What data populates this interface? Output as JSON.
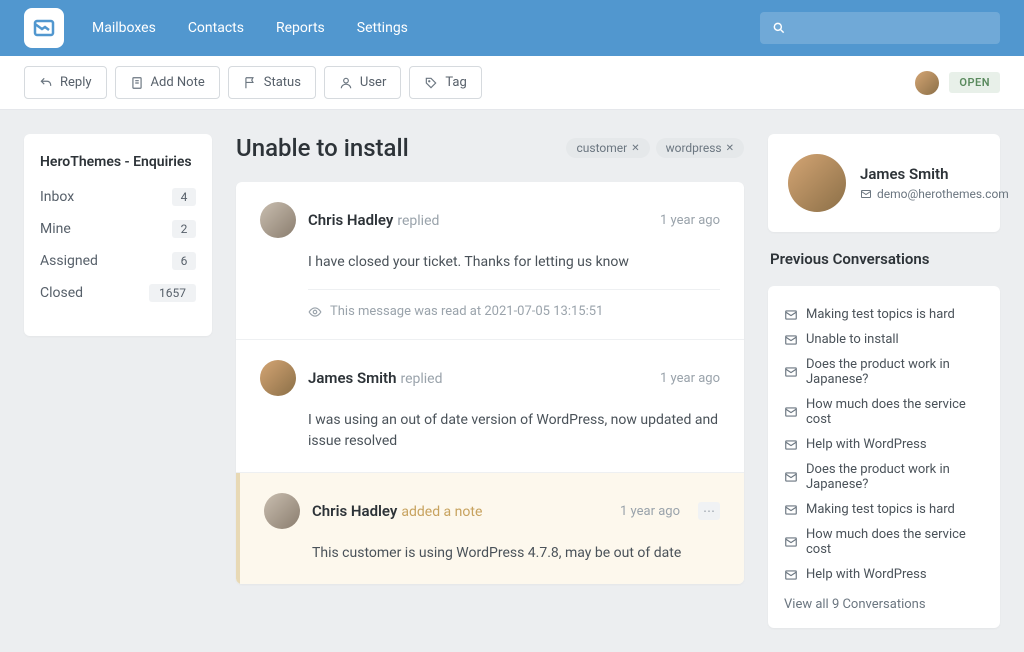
{
  "nav": {
    "items": [
      "Mailboxes",
      "Contacts",
      "Reports",
      "Settings"
    ]
  },
  "toolbar": {
    "reply": "Reply",
    "add_note": "Add Note",
    "status": "Status",
    "user": "User",
    "tag": "Tag",
    "status_badge": "OPEN"
  },
  "sidebar": {
    "title": "HeroThemes - Enquiries",
    "items": [
      {
        "label": "Inbox",
        "count": "4"
      },
      {
        "label": "Mine",
        "count": "2"
      },
      {
        "label": "Assigned",
        "count": "6"
      },
      {
        "label": "Closed",
        "count": "1657"
      }
    ]
  },
  "ticket": {
    "title": "Unable to install",
    "tags": [
      "customer",
      "wordpress"
    ]
  },
  "messages": [
    {
      "author": "Chris Hadley",
      "action": "replied",
      "time": "1 year ago",
      "body": "I have closed your ticket. Thanks for letting us know",
      "read_at": "This message was read at 2021-07-05 13:15:51"
    },
    {
      "author": "James Smith",
      "action": "replied",
      "time": "1 year ago",
      "body": "I was using an out of date version of WordPress, now updated and issue resolved"
    },
    {
      "author": "Chris Hadley",
      "action": "added a note",
      "time": "1 year ago",
      "body": "This customer is using WordPress 4.7.8, may be out of date"
    }
  ],
  "customer": {
    "name": "James Smith",
    "email": "demo@herothemes.com"
  },
  "previous": {
    "title": "Previous Conversations",
    "items": [
      "Making test topics is hard",
      "Unable to install",
      "Does the product work in Japanese?",
      "How much does the service cost",
      "Help with WordPress",
      "Does the product work in Japanese?",
      "Making test topics is hard",
      "How much does the service cost",
      "Help with WordPress"
    ],
    "view_all": "View all 9 Conversations"
  }
}
